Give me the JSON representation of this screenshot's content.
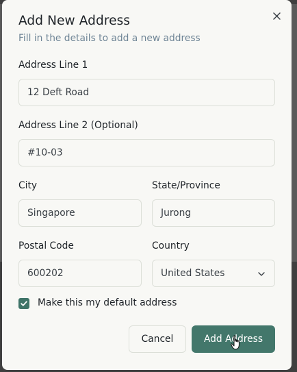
{
  "dialog": {
    "title": "Add New Address",
    "subtitle": "Fill in the details to add a new address",
    "close_icon": "close-icon"
  },
  "form": {
    "address_line_1": {
      "label": "Address Line 1",
      "value": "12 Deft Road"
    },
    "address_line_2": {
      "label": "Address Line 2 (Optional)",
      "value": "#10-03"
    },
    "city": {
      "label": "City",
      "value": "Singapore"
    },
    "state": {
      "label": "State/Province",
      "value": "Jurong"
    },
    "postal_code": {
      "label": "Postal Code",
      "value": "600202"
    },
    "country": {
      "label": "Country",
      "value": "United States",
      "icon": "chevron-down-icon"
    },
    "default_address": {
      "label": "Make this my default address",
      "checked": true
    }
  },
  "actions": {
    "cancel_label": "Cancel",
    "submit_label": "Add Address"
  },
  "colors": {
    "accent": "#43776b",
    "checkbox": "#3f7468",
    "subtitle": "#6f8596",
    "border": "#dcdfd8",
    "dialog_bg": "#f8f8f5"
  }
}
